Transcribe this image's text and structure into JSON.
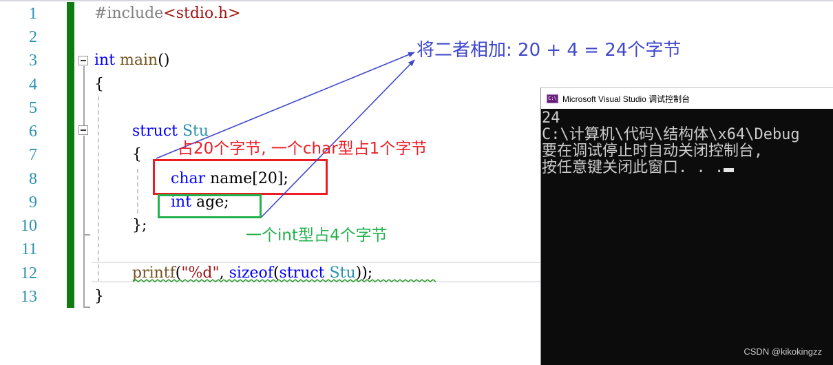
{
  "editor": {
    "line_numbers": [
      "1",
      "2",
      "3",
      "4",
      "5",
      "6",
      "7",
      "8",
      "9",
      "10",
      "11",
      "12",
      "13"
    ],
    "lines": {
      "l1": {
        "pre": "#include",
        "hdr": "<stdio.h>"
      },
      "l3": {
        "kw": "int",
        "sp": " ",
        "fn": "main",
        "rest": "()"
      },
      "l4": {
        "text": "{"
      },
      "l6": {
        "kw": "struct",
        "sp": " ",
        "typ": "Stu"
      },
      "l7": {
        "text": "{"
      },
      "l8": {
        "kw": "char",
        "rest": " name[20];"
      },
      "l9": {
        "kw": "int",
        "rest": " age;"
      },
      "l10": {
        "text": "};"
      },
      "l12": {
        "fn": "printf",
        "p1": "(",
        "str": "\"%d\"",
        "comma": ", ",
        "kw1": "sizeof",
        "p2": "(",
        "kw2": "struct",
        "sp": " ",
        "typ": "Stu",
        "p3": "));"
      },
      "l13": {
        "text": "}"
      }
    }
  },
  "annotations": {
    "sum_text": "将二者相加: 20 + 4 = 24个字节",
    "char_text": "占20个字节, 一个char型占1个字节",
    "int_text": "一个int型占4个字节",
    "colors": {
      "sum": "#3f48cc",
      "char": "#ed1c24",
      "int": "#22b14c",
      "arrow": "#3f48cc"
    }
  },
  "console": {
    "title": "Microsoft Visual Studio 调试控制台",
    "icon_label": "C:\\",
    "output_lines": [
      "24",
      "C:\\计算机\\代码\\结构体\\x64\\Debug",
      "要在调试停止时自动关闭控制台,",
      "按任意键关闭此窗口. . ."
    ]
  },
  "watermark": "CSDN @kikokingzz"
}
